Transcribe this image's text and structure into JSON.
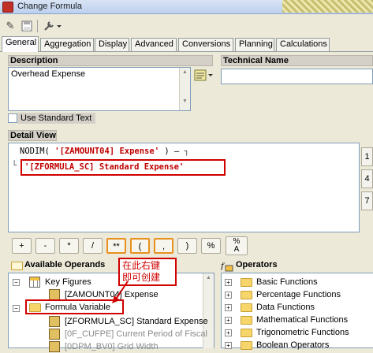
{
  "window": {
    "title": "Change Formula"
  },
  "tabs": [
    {
      "label": "General",
      "active": true
    },
    {
      "label": "Aggregation"
    },
    {
      "label": "Display"
    },
    {
      "label": "Advanced"
    },
    {
      "label": "Conversions"
    },
    {
      "label": "Planning"
    },
    {
      "label": "Calculations"
    }
  ],
  "description": {
    "header": "Description",
    "value": "Overhead Expense",
    "use_standard_text": "Use Standard Text"
  },
  "technical_name": {
    "header": "Technical Name",
    "value": ""
  },
  "detail_view": {
    "header": "Detail View",
    "line1_prefix": "NODIM( ",
    "line1_var": "'[ZAMOUNT04] Expense'",
    "line1_suffix": " ) –",
    "line2": "'[ZFORMULA_SC] Standard Expense'",
    "side_buttons": [
      "1",
      "4",
      "7"
    ]
  },
  "operator_buttons": [
    "+",
    "-",
    "*",
    "/",
    "**",
    "(",
    ",",
    ")",
    "%",
    "%\nA"
  ],
  "available_operands": {
    "header": "Available Operands",
    "items": [
      {
        "label": "Key Figures"
      },
      {
        "label": "[ZAMOUNT04] Expense"
      },
      {
        "label": "Formula Variable"
      },
      {
        "label": "[ZFORMULA_SC] Standard Expense"
      },
      {
        "label": "[0F_CUFPE] Current Period of Fiscal"
      },
      {
        "label": "[0DPM_BV0] Grid Width"
      }
    ]
  },
  "callout": {
    "line1": "在此右键",
    "line2": "即可创建"
  },
  "operators": {
    "header": "Operators",
    "items": [
      "Basic Functions",
      "Percentage Functions",
      "Data Functions",
      "Mathematical Functions",
      "Trigonometric Functions",
      "Boolean Operators"
    ]
  },
  "colors": {
    "highlight": "#d00000",
    "variable_text": "#c00000"
  }
}
